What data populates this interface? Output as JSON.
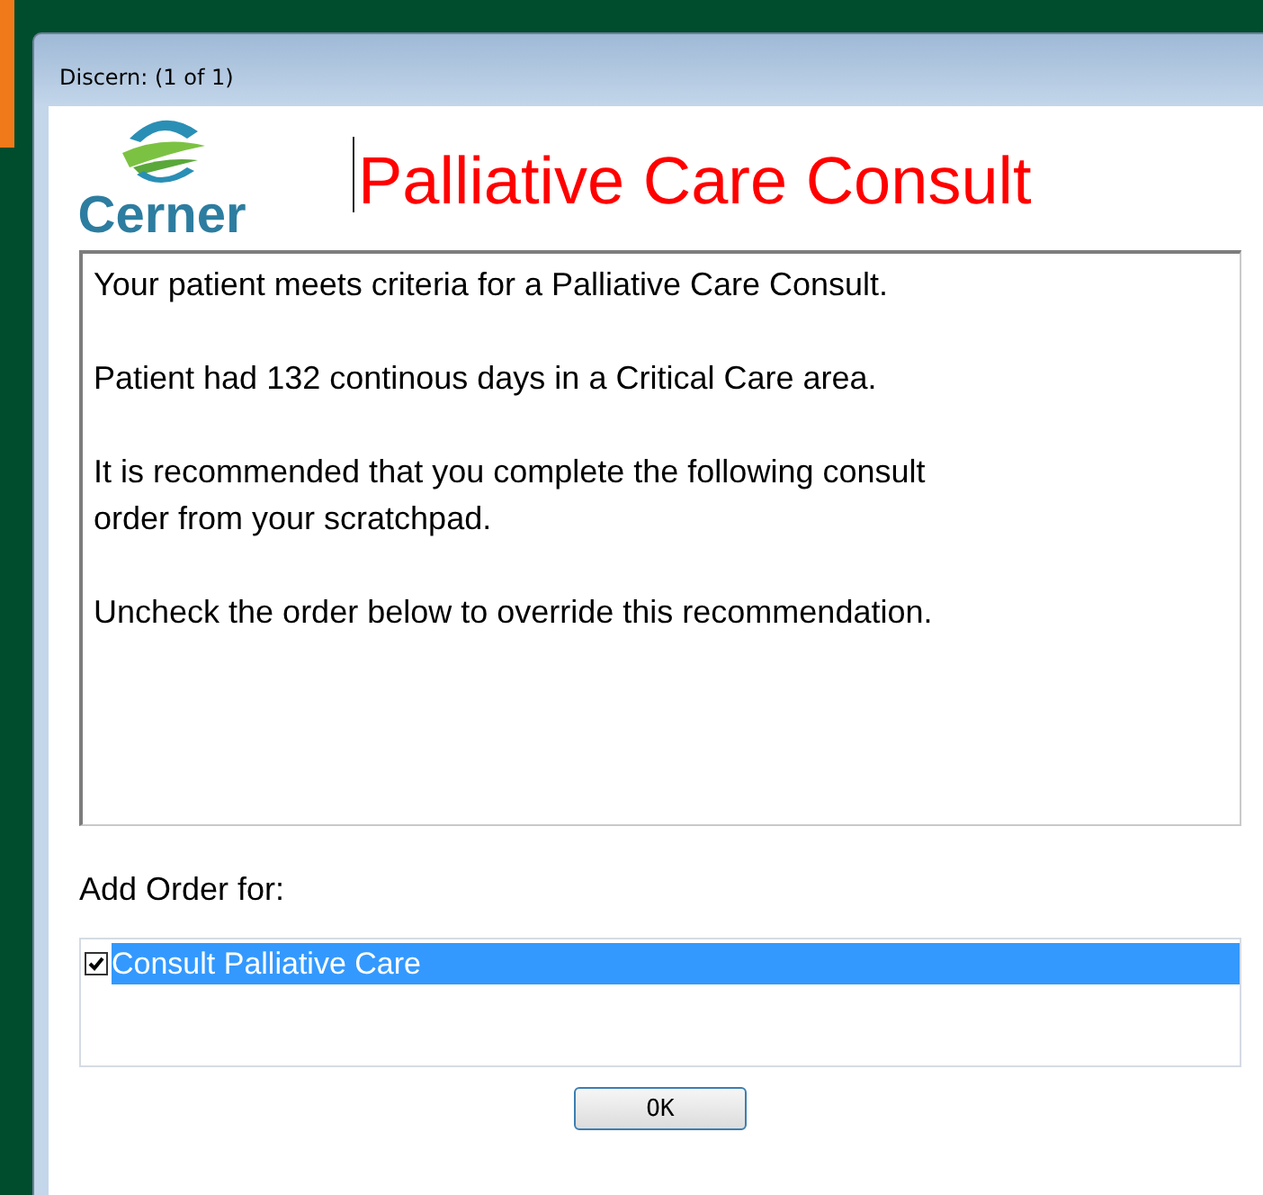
{
  "window": {
    "title": "Discern:  (1 of 1)"
  },
  "logo": {
    "text": "Cerner"
  },
  "heading": "Palliative Care Consult",
  "message": {
    "paragraphs": [
      [
        "Your patient meets criteria for a Palliative Care Consult."
      ],
      [
        "Patient had 132 continous days in a Critical Care area."
      ],
      [
        "It is recommended that you complete the following consult",
        "order from your scratchpad."
      ],
      [
        "Uncheck the order below to override this recommendation."
      ]
    ]
  },
  "orders": {
    "label": "Add Order for:",
    "items": [
      {
        "label": "Consult Palliative Care",
        "checked": true,
        "selected": true
      }
    ]
  },
  "buttons": [
    "OK"
  ]
}
